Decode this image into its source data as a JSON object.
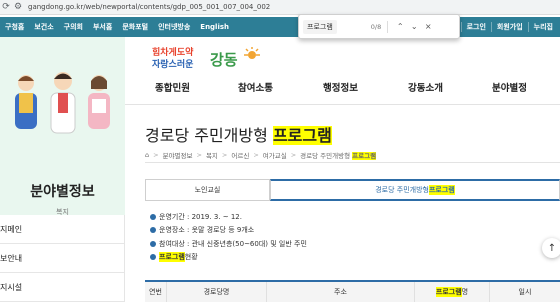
{
  "browser": {
    "url": "gangdong.go.kr/web/newportal/contents/gdp_005_001_007_004_002"
  },
  "find": {
    "query": "프로그램",
    "count": "0/8",
    "up": "⌃",
    "down": "⌄",
    "close": "×"
  },
  "topnav": {
    "items": [
      "구청홈",
      "보건소",
      "구의회",
      "부서홈",
      "문화포털",
      "인터넷방송",
      "English"
    ],
    "right_items": [
      "로그인",
      "회원가입",
      "누리집"
    ]
  },
  "sidebar": {
    "title": "분야별정보",
    "subtitle": "복지",
    "menu": [
      "지메인",
      "보안내",
      "지시설"
    ]
  },
  "logo": {
    "slogan_line1": "힘차게도약",
    "slogan_line2": "자랑스러운",
    "name": "강동"
  },
  "gnb": [
    "종합민원",
    "참여소통",
    "행정정보",
    "강동소개",
    "분야별정"
  ],
  "page": {
    "title_prefix": "경로당 주민개방형 ",
    "title_highlight": "프로그램",
    "breadcrumb": [
      "분야별정보",
      "복지",
      "어르신",
      "여가교실"
    ],
    "breadcrumb_last_prefix": "경로당 주민개방형 ",
    "breadcrumb_last_highlight": "프로그램"
  },
  "tabs": {
    "tab1": "노인교실",
    "tab2_prefix": "경로당 주민개방형 ",
    "tab2_highlight": "프로그램"
  },
  "bullets": {
    "b1": "운영기간 : 2019. 3. ~ 12.",
    "b2": "운영장소 : 옷말 경로당 등 9개소",
    "b3": "참여대상 : 관내 신중년층(50~60대) 및 일반 주민",
    "b4_highlight": "프로그램",
    "b4_suffix": " 현황"
  },
  "table": {
    "col1": "연번",
    "col2": "경로당명",
    "col3": "주소",
    "col4_highlight": "프로그램",
    "col4_suffix": "명",
    "col5": "일시"
  },
  "colors": {
    "topnav": "#2d7e96",
    "accent": "#2d6ca6",
    "highlight": "#ffff00",
    "sidebar_bg": "#e9f7ef"
  }
}
